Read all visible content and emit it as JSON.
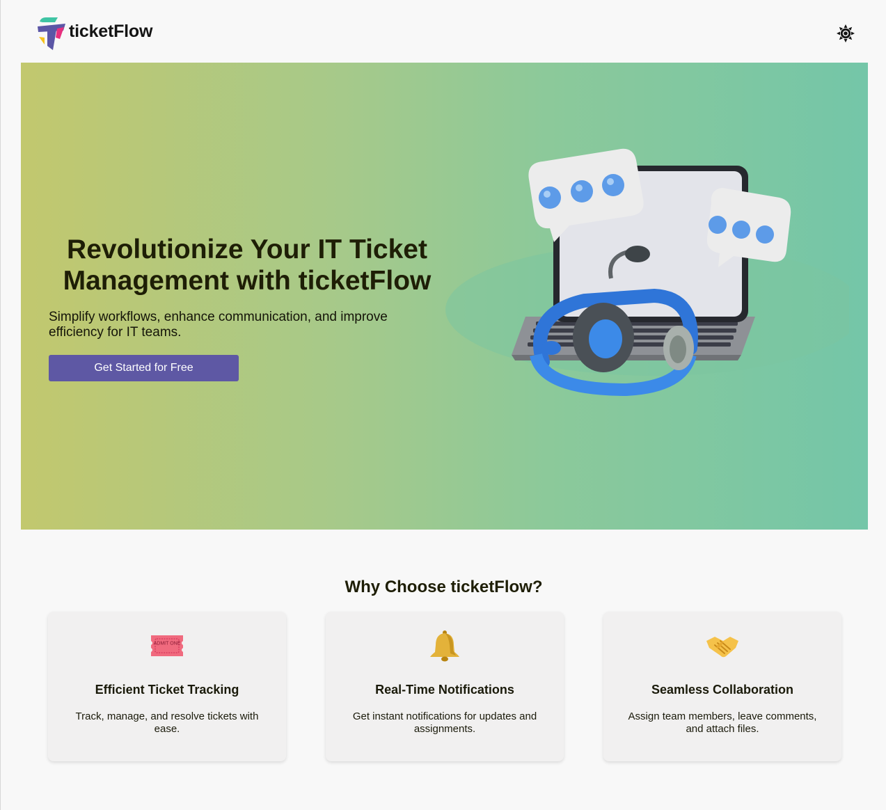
{
  "header": {
    "brand_name": "ticketFlow",
    "theme_toggle_icon": "sun-icon"
  },
  "hero": {
    "title": "Revolutionize Your IT Ticket Management with ticketFlow",
    "subtitle": "Simplify workflows, enhance communication, and improve efficiency for IT teams.",
    "cta_label": "Get Started for Free",
    "illustration": "laptop-headset-chat-illustration"
  },
  "features": {
    "title": "Why Choose ticketFlow?",
    "items": [
      {
        "icon": "ticket-icon",
        "title": "Efficient Ticket Tracking",
        "text": "Track, manage, and resolve tickets with ease."
      },
      {
        "icon": "bell-icon",
        "title": "Real-Time Notifications",
        "text": "Get instant notifications for updates and assignments."
      },
      {
        "icon": "handshake-icon",
        "title": "Seamless Collaboration",
        "text": "Assign team members, leave comments, and attach files."
      }
    ],
    "ticket_icon_text": "ADMIT ONE"
  },
  "colors": {
    "primary": "#5e58a4",
    "hero_gradient_start": "#c2c86e",
    "hero_gradient_end": "#74c6a8",
    "page_background": "#f8f8f8",
    "card_background": "#f1f0f0"
  }
}
